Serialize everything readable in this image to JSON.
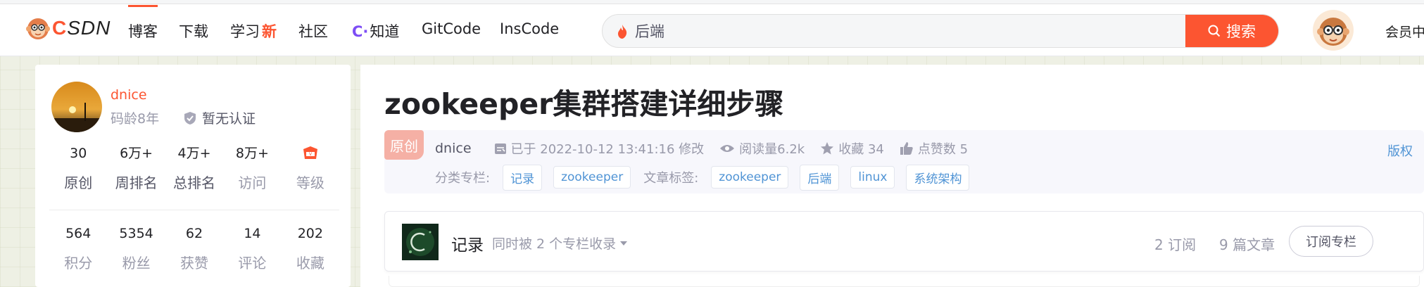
{
  "nav": {
    "brand": "CSDN",
    "items": [
      "博客",
      "下载",
      "学习",
      "社区",
      "知道",
      "GitCode",
      "InsCode"
    ],
    "learn_badge": "新",
    "search_value": "后端",
    "search_button": "搜索",
    "member": "会员中"
  },
  "profile": {
    "name": "dnice",
    "code_age": "码龄8年",
    "certification": "暂无认证",
    "stats_top": [
      {
        "num": "30",
        "label": "原创"
      },
      {
        "num": "6万+",
        "label": "周排名"
      },
      {
        "num": "4万+",
        "label": "总排名"
      },
      {
        "num": "8万+",
        "label": "访问"
      },
      {
        "num": "",
        "label": "等级"
      }
    ],
    "stats_bottom": [
      {
        "num": "564",
        "label": "积分"
      },
      {
        "num": "5354",
        "label": "粉丝"
      },
      {
        "num": "62",
        "label": "获赞"
      },
      {
        "num": "14",
        "label": "评论"
      },
      {
        "num": "202",
        "label": "收藏"
      }
    ]
  },
  "article": {
    "title": "zookeeper集群搭建详细步骤",
    "original_badge": "原创",
    "author": "dnice",
    "modified": "已于 2022-10-12 13:41:16 修改",
    "reads": "阅读量6.2k",
    "favorites": "收藏 34",
    "likes": "点赞数 5",
    "copyright": "版权",
    "category_label": "分类专栏:",
    "categories": [
      "记录",
      "zookeeper"
    ],
    "tags_label": "文章标签:",
    "tags": [
      "zookeeper",
      "后端",
      "linux",
      "系统架构"
    ]
  },
  "column": {
    "name": "记录",
    "multi": "同时被 2 个专栏收录",
    "subscribers": "2 订阅",
    "articles": "9 篇文章",
    "subscribe_button": "订阅专栏"
  },
  "colors": {
    "accent": "#fc5531",
    "link": "#5094d5",
    "muted": "#999aaa"
  }
}
